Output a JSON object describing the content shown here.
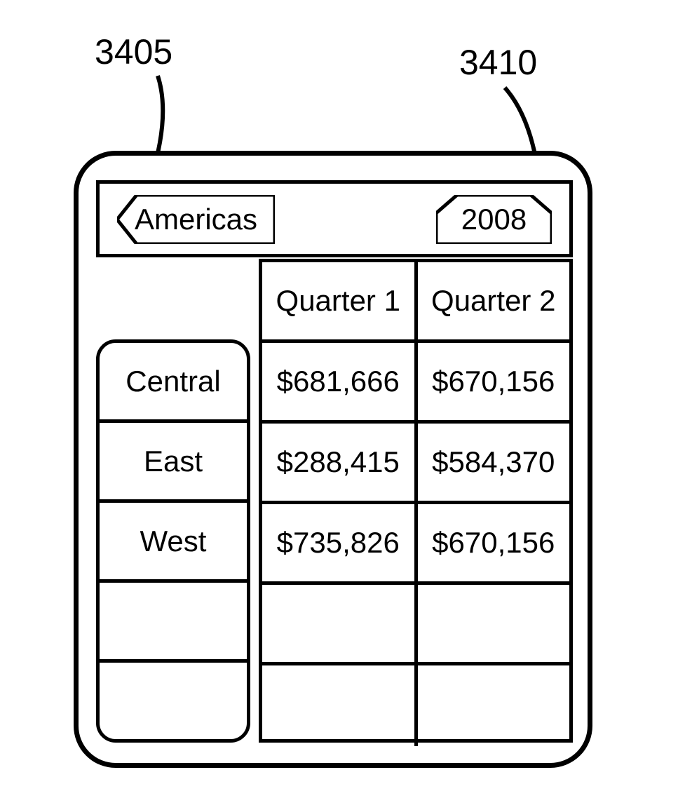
{
  "callouts": {
    "left": "3405",
    "right": "3410"
  },
  "filters": {
    "region": "Americas",
    "year": "2008"
  },
  "columns": [
    "Quarter 1",
    "Quarter 2"
  ],
  "rows": [
    {
      "label": "Central",
      "cells": [
        "$681,666",
        "$670,156"
      ]
    },
    {
      "label": "East",
      "cells": [
        "$288,415",
        "$584,370"
      ]
    },
    {
      "label": "West",
      "cells": [
        "$735,826",
        "$670,156"
      ]
    },
    {
      "label": "",
      "cells": [
        "",
        ""
      ]
    },
    {
      "label": "",
      "cells": [
        "",
        ""
      ]
    }
  ],
  "chart_data": {
    "type": "table",
    "title": "",
    "row_dimension": "Region (Americas)",
    "column_dimension": "Quarter (2008)",
    "columns": [
      "Quarter 1",
      "Quarter 2"
    ],
    "rows": [
      "Central",
      "East",
      "West"
    ],
    "values": [
      [
        681666,
        670156
      ],
      [
        288415,
        584370
      ],
      [
        735826,
        670156
      ]
    ],
    "format": "currency-usd"
  }
}
